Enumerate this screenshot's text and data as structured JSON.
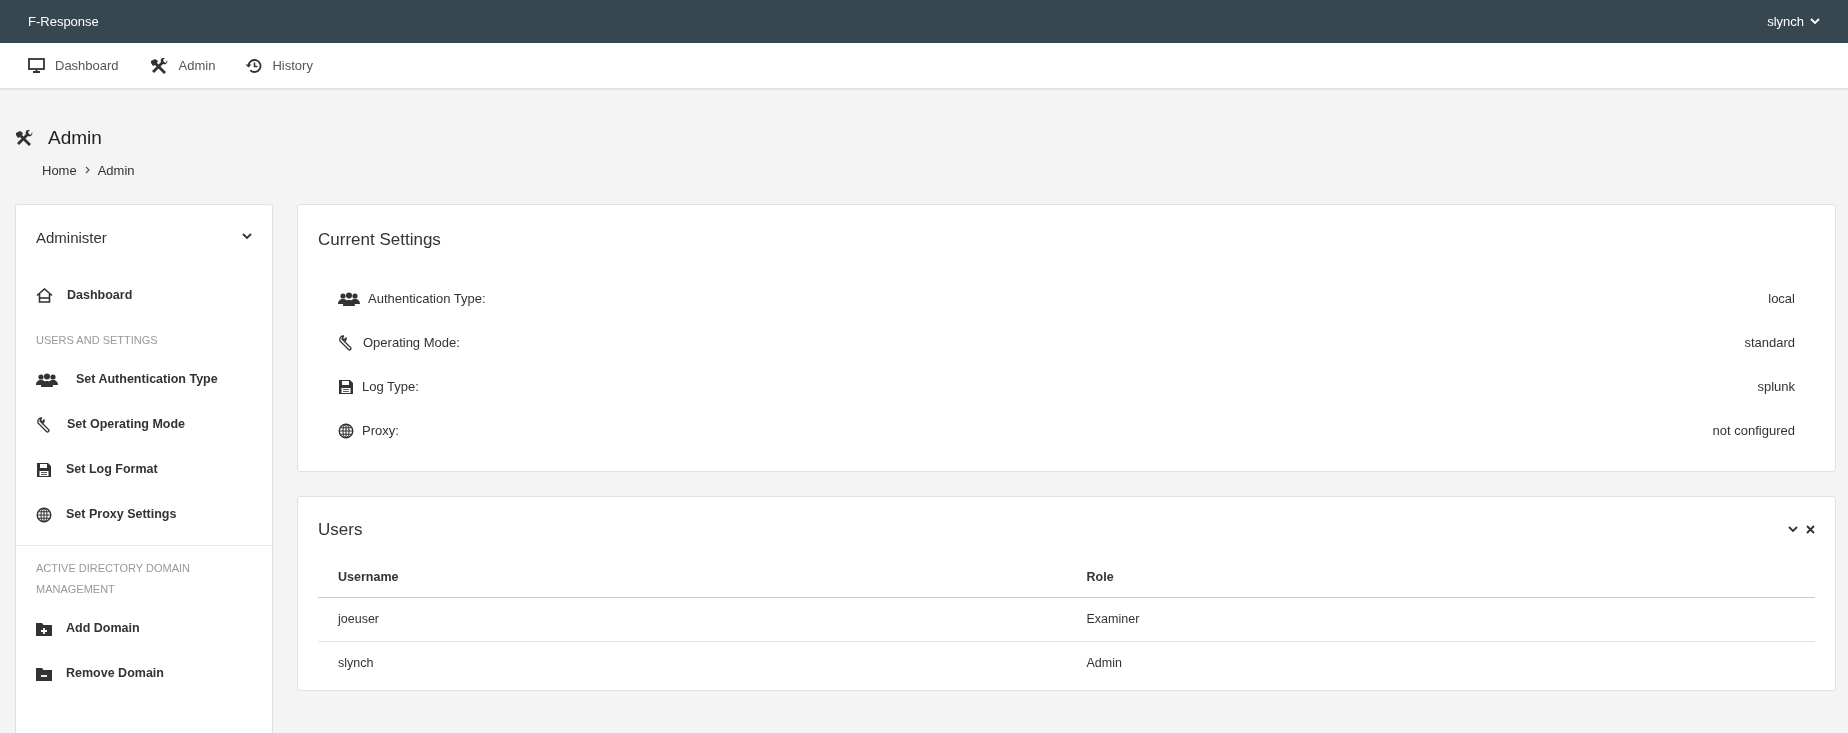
{
  "app": {
    "brand": "F-Response",
    "user": "slynch"
  },
  "nav": [
    {
      "label": "Dashboard",
      "selected": false
    },
    {
      "label": "Admin",
      "selected": false
    },
    {
      "label": "History",
      "selected": false
    }
  ],
  "page": {
    "title": "Admin",
    "breadcrumb": [
      "Home",
      "Admin"
    ]
  },
  "sidebar": {
    "title": "Administer",
    "expanded": true,
    "groups": [
      {
        "items": [
          "Dashboard"
        ]
      },
      {
        "heading": "USERS AND SETTINGS",
        "items": [
          "Set Authentication Type",
          "Set Operating Mode",
          "Set Log Format",
          "Set Proxy Settings"
        ]
      },
      {
        "heading": "ACTIVE DIRECTORY DOMAIN MANAGEMENT",
        "items": [
          "Add Domain",
          "Remove Domain"
        ]
      }
    ]
  },
  "settings": {
    "title": "Current Settings",
    "rows": [
      {
        "label": "Authentication Type:",
        "value": "local"
      },
      {
        "label": "Operating Mode:",
        "value": "standard"
      },
      {
        "label": "Log Type:",
        "value": "splunk"
      },
      {
        "label": "Proxy:",
        "value": "not configured"
      }
    ]
  },
  "users": {
    "title": "Users",
    "columns": [
      "Username",
      "Role"
    ],
    "rows": [
      [
        "joeuser",
        "Examiner"
      ],
      [
        "slynch",
        "Admin"
      ]
    ]
  }
}
